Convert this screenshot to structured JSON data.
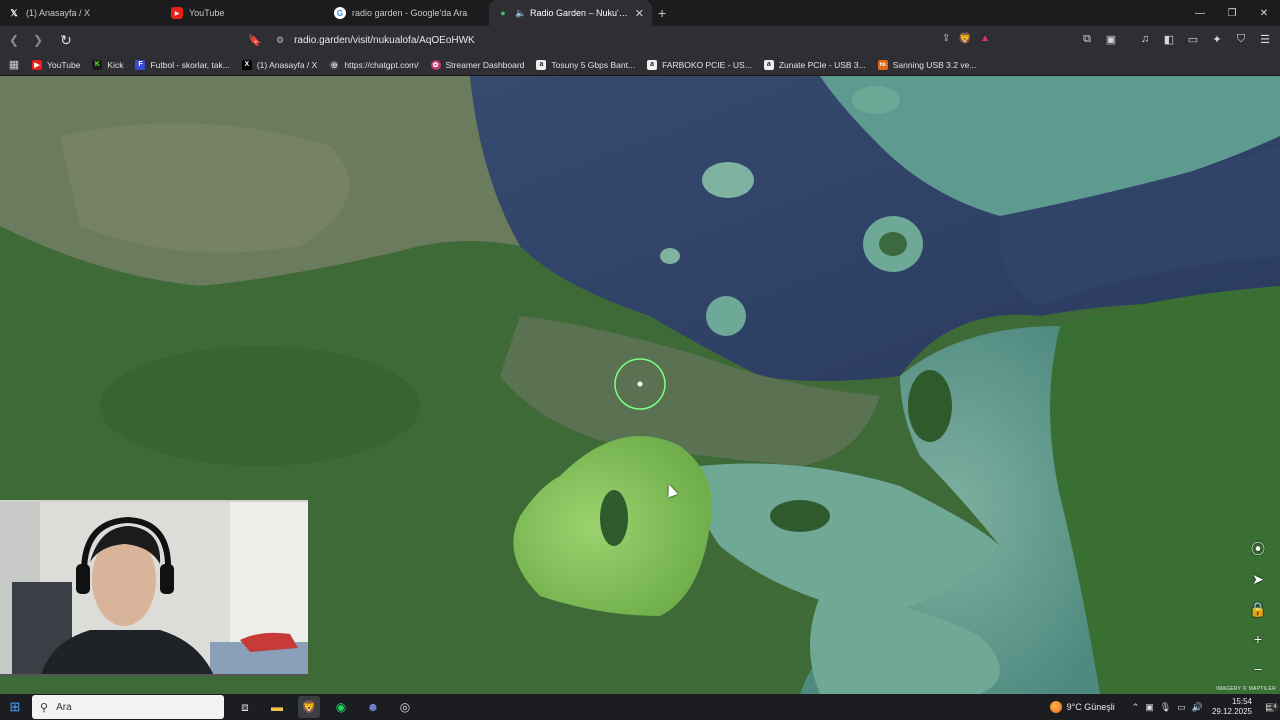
{
  "browser": {
    "tabs": [
      {
        "title": "(1) Anasayfa / X",
        "icon": "x-logo-icon",
        "active": false
      },
      {
        "title": "YouTube",
        "icon": "youtube-icon",
        "active": false
      },
      {
        "title": "radio garden - Google'da Ara",
        "icon": "google-icon",
        "active": false
      },
      {
        "title": "Radio Garden – Nuku'alofa",
        "icon": "audio-playing-icon",
        "active": true
      }
    ],
    "new_tab_glyph": "+",
    "url": "radio.garden/visit/nukualofa/AqOEoHWK",
    "bookmarks": [
      {
        "label": "YouTube",
        "color": "#e62117",
        "glyph": "▶"
      },
      {
        "label": "Kick",
        "color": "#1a1a1a",
        "glyph": "K"
      },
      {
        "label": "Futbol - skorlar, tak...",
        "color": "#3a4bd8",
        "glyph": "F"
      },
      {
        "label": "(1) Anasayfa / X",
        "color": "#000000",
        "glyph": "X"
      },
      {
        "label": "https://chatgpt.com/",
        "color": "#444444",
        "glyph": "◎"
      },
      {
        "label": "Streamer Dashboard",
        "color": "#c43a6a",
        "glyph": "✿"
      },
      {
        "label": "Tosuny 5 Gbps Bant...",
        "color": "#222222",
        "glyph": "a"
      },
      {
        "label": "FARBOKO PCIE - US...",
        "color": "#222222",
        "glyph": "a"
      },
      {
        "label": "Zunate PCIe - USB 3...",
        "color": "#222222",
        "glyph": "a"
      },
      {
        "label": "Sanning USB 3.2 ve...",
        "color": "#e06a1a",
        "glyph": "hb"
      }
    ]
  },
  "map": {
    "attribution": "IMAGERY © MAPTILER",
    "controls": [
      "radio-tower-icon",
      "locate-icon",
      "lock-icon",
      "zoom-in-icon",
      "zoom-out-icon"
    ]
  },
  "taskbar": {
    "search_placeholder": "Ara",
    "weather": "9°C Güneşli",
    "time": "15:54",
    "date": "29.12.2025",
    "notification_count": "4"
  }
}
